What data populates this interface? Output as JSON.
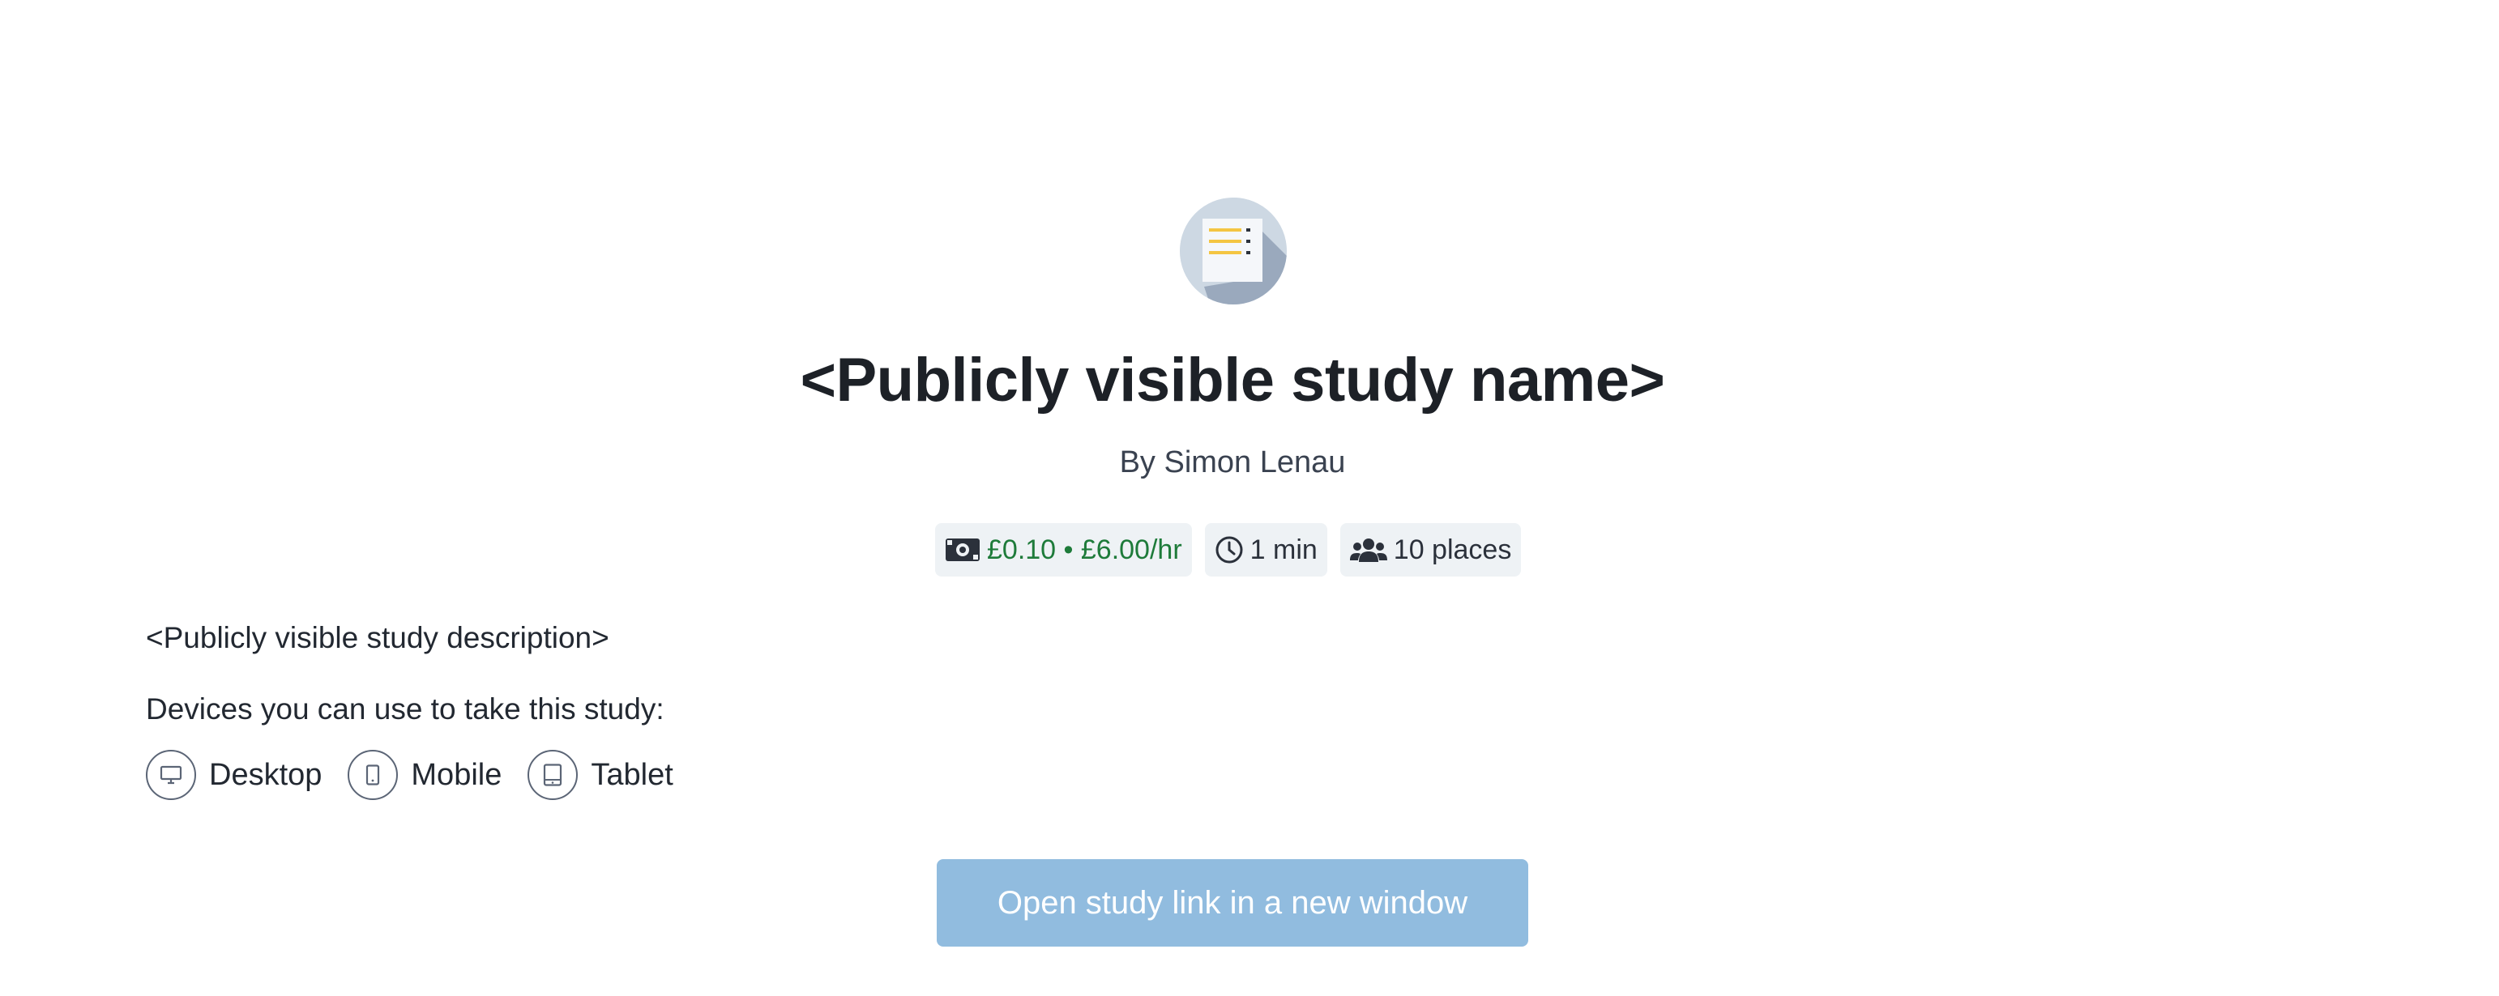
{
  "study": {
    "icon": "document-list-icon",
    "name": "<Publicly visible study name>",
    "author": "By Simon Lenau",
    "badges": {
      "reward": {
        "icon": "money-icon",
        "text": "£0.10 • £6.00/hr",
        "color": "#1e7b3a"
      },
      "duration": {
        "icon": "clock-icon",
        "text": "1 min"
      },
      "places": {
        "icon": "users-icon",
        "text": "10 places"
      }
    },
    "description": "<Publicly visible study description>",
    "devices_label": "Devices you can use to take this study:",
    "devices": [
      {
        "icon": "desktop-icon",
        "label": "Desktop"
      },
      {
        "icon": "mobile-icon",
        "label": "Mobile"
      },
      {
        "icon": "tablet-icon",
        "label": "Tablet"
      }
    ],
    "open_button": "Open study link in a new window"
  },
  "colors": {
    "button_bg": "#91bcdf",
    "badge_bg": "#eef2f5",
    "icon_circle": "#cdd8e3"
  }
}
